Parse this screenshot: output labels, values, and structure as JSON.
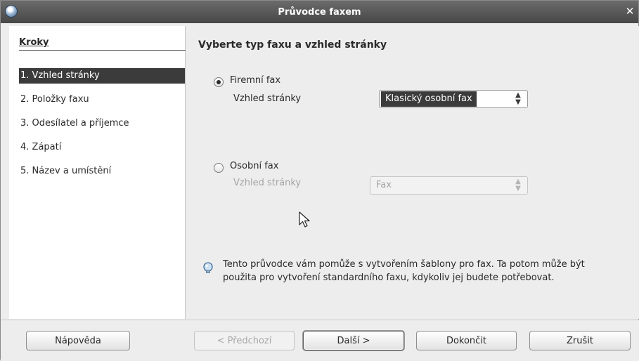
{
  "window": {
    "title": "Průvodce faxem"
  },
  "sidebar": {
    "title": "Kroky",
    "steps": [
      {
        "label": "1. Vzhled stránky",
        "active": true
      },
      {
        "label": "2. Položky faxu",
        "active": false
      },
      {
        "label": "3. Odesílatel a příjemce",
        "active": false
      },
      {
        "label": "4. Zápatí",
        "active": false
      },
      {
        "label": "5. Název a umístění",
        "active": false
      }
    ]
  },
  "main": {
    "heading": "Vyberte typ faxu a vzhled stránky",
    "business_fax": {
      "label": "Firemní fax",
      "selected": true,
      "layout_label": "Vzhled stránky",
      "layout_value": "Klasický osobní fax"
    },
    "personal_fax": {
      "label": "Osobní fax",
      "selected": false,
      "layout_label": "Vzhled stránky",
      "layout_value": "Fax"
    },
    "info_text": "Tento průvodce vám pomůže s vytvořením šablony pro fax. Ta potom může být použita pro vytvoření standardního faxu, kdykoliv jej budete potřebovat."
  },
  "buttons": {
    "help": "Nápověda",
    "back": "< Předchozí",
    "next": "Další >",
    "finish": "Dokončit",
    "cancel": "Zrušit"
  },
  "icons": {
    "app": "wizard-app-icon",
    "close": "close-icon",
    "spinner": "up-down-spinner-icon",
    "info": "info-lightbulb-icon",
    "cursor": "mouse-pointer-icon"
  }
}
